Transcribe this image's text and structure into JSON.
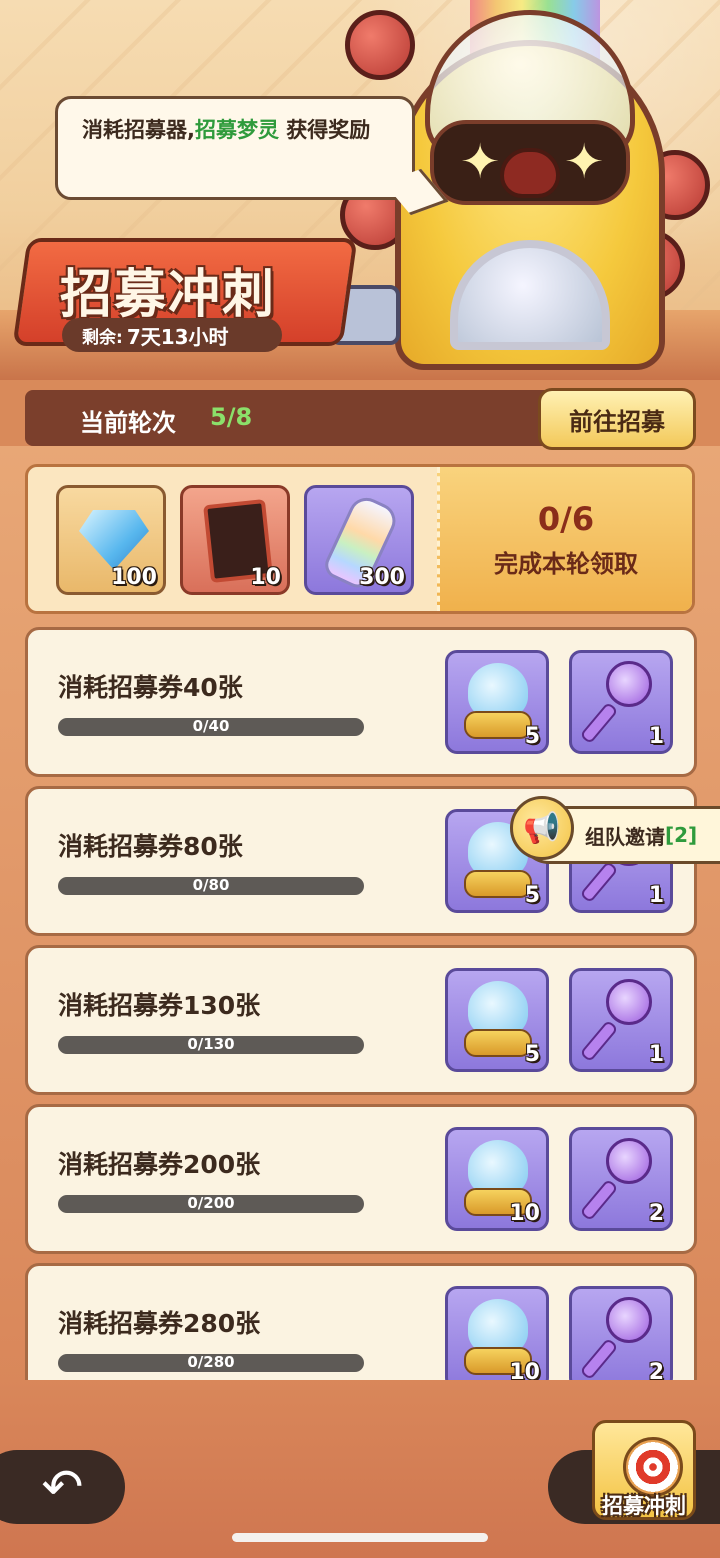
{
  "banner": {
    "speech_prefix": "消耗招募器,",
    "speech_highlight": "招募梦灵",
    "speech_suffix": " 获得奖励",
    "title": "招募冲刺",
    "remaining_label": "剩余:",
    "remaining_value": "7天13小时"
  },
  "round": {
    "label": "当前轮次",
    "value": "5/8",
    "goto_button": "前往招募"
  },
  "round_reward": {
    "items": [
      {
        "icon": "diamond-icon",
        "count": "100"
      },
      {
        "icon": "card-fragment-icon",
        "count": "10"
      },
      {
        "icon": "rainbow-bottle-icon",
        "count": "300"
      }
    ],
    "progress": "0/6",
    "claim_text": "完成本轮领取"
  },
  "tasks": [
    {
      "label": "消耗招募券40张",
      "progress_text": "0/40",
      "progress_fraction": 0,
      "rewards": [
        {
          "icon": "spirit-core-icon",
          "count": "5"
        },
        {
          "icon": "purple-key-icon",
          "count": "1"
        }
      ]
    },
    {
      "label": "消耗招募券80张",
      "progress_text": "0/80",
      "progress_fraction": 0,
      "rewards": [
        {
          "icon": "spirit-core-icon",
          "count": "5"
        },
        {
          "icon": "purple-key-icon",
          "count": "1"
        }
      ]
    },
    {
      "label": "消耗招募券130张",
      "progress_text": "0/130",
      "progress_fraction": 0,
      "rewards": [
        {
          "icon": "spirit-core-icon",
          "count": "5"
        },
        {
          "icon": "purple-key-icon",
          "count": "1"
        }
      ]
    },
    {
      "label": "消耗招募券200张",
      "progress_text": "0/200",
      "progress_fraction": 0,
      "rewards": [
        {
          "icon": "spirit-core-icon",
          "count": "10"
        },
        {
          "icon": "purple-key-icon",
          "count": "2"
        }
      ]
    },
    {
      "label": "消耗招募券280张",
      "progress_text": "0/280",
      "progress_fraction": 0,
      "rewards": [
        {
          "icon": "spirit-core-icon",
          "count": "10"
        },
        {
          "icon": "purple-key-icon",
          "count": "2"
        }
      ]
    }
  ],
  "invite": {
    "label": "组队邀请",
    "count": "[2]"
  },
  "bottom": {
    "back_icon": "back-arrow-icon",
    "shortcut_label": "招募冲刺"
  },
  "colors": {
    "accent_green": "#2f9b3c",
    "progress_green": "#8be06a",
    "title_red": "#d4402a"
  }
}
